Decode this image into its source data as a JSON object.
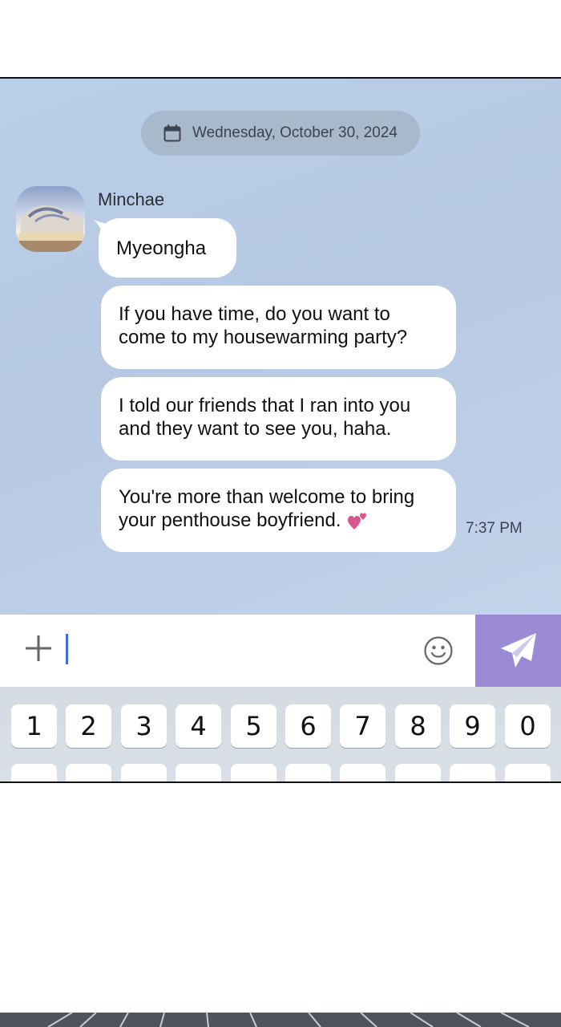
{
  "date_label": "Wednesday, October 30, 2024",
  "sender_name": "Minchae",
  "messages": [
    {
      "lines": [
        "Myeongha"
      ]
    },
    {
      "lines": [
        "If you have time, do you want to",
        "come to my housewarming party?"
      ]
    },
    {
      "lines": [
        "I told our friends that I ran into you",
        "and they want to see you, haha."
      ]
    },
    {
      "lines": [
        "You're more than welcome to bring",
        "your penthouse boyfriend."
      ]
    }
  ],
  "timestamp": "7:37 PM",
  "keyboard_keys": [
    "1",
    "2",
    "3",
    "4",
    "5",
    "6",
    "7",
    "8",
    "9",
    "0"
  ],
  "icons": {
    "date": "calendar-icon",
    "attach": "plus-icon",
    "emoji": "smiley-icon",
    "send": "paper-plane-icon",
    "message_heart": "hearts-icon"
  },
  "colors": {
    "chat_background": "#b9cfe8",
    "send_button": "#9a8ad6",
    "heart": "#d9578f"
  }
}
